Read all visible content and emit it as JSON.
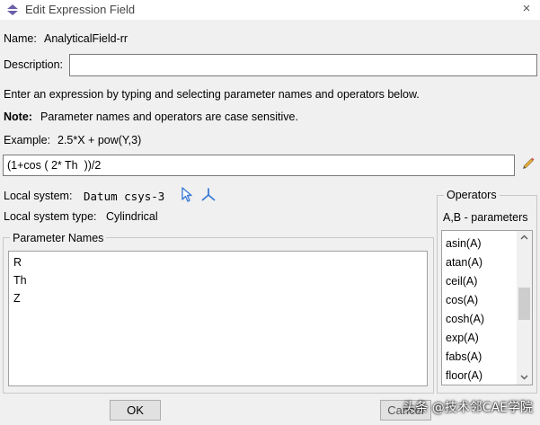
{
  "window": {
    "title": "Edit Expression Field",
    "close_glyph": "×"
  },
  "name": {
    "label": "Name:",
    "value": "AnalyticalField-rr"
  },
  "description": {
    "label": "Description:",
    "value": ""
  },
  "instructions": "Enter an expression by typing and selecting parameter names and operators below.",
  "note": {
    "label": "Note:",
    "text": "Parameter names and operators are case sensitive."
  },
  "example": {
    "label": "Example:",
    "text": "2.5*X + pow(Y,3)"
  },
  "expression": {
    "value": "(1+cos ( 2* Th  ))/2",
    "edit_icon": "pencil-icon"
  },
  "local_system": {
    "label": "Local system:",
    "value": "Datum csys-3",
    "pick_icon": "cursor-arrow-icon",
    "axes_icon": "axes-triad-icon"
  },
  "local_system_type": {
    "label": "Local system type:",
    "value": "Cylindrical"
  },
  "parameter_names": {
    "title": "Parameter Names",
    "items": [
      "R",
      "Th",
      "Z"
    ]
  },
  "operators": {
    "title": "Operators",
    "subtitle": "A,B - parameters",
    "items": [
      "asin(A)",
      "atan(A)",
      "ceil(A)",
      "cos(A)",
      "cosh(A)",
      "exp(A)",
      "fabs(A)",
      "floor(A)"
    ]
  },
  "buttons": {
    "ok": "OK",
    "cancel": "Cancel"
  },
  "watermark": "头条 @技术邻CAE学院",
  "colors": {
    "icon_blue": "#3a7bd5",
    "title_icon": "#6a5fa8"
  }
}
